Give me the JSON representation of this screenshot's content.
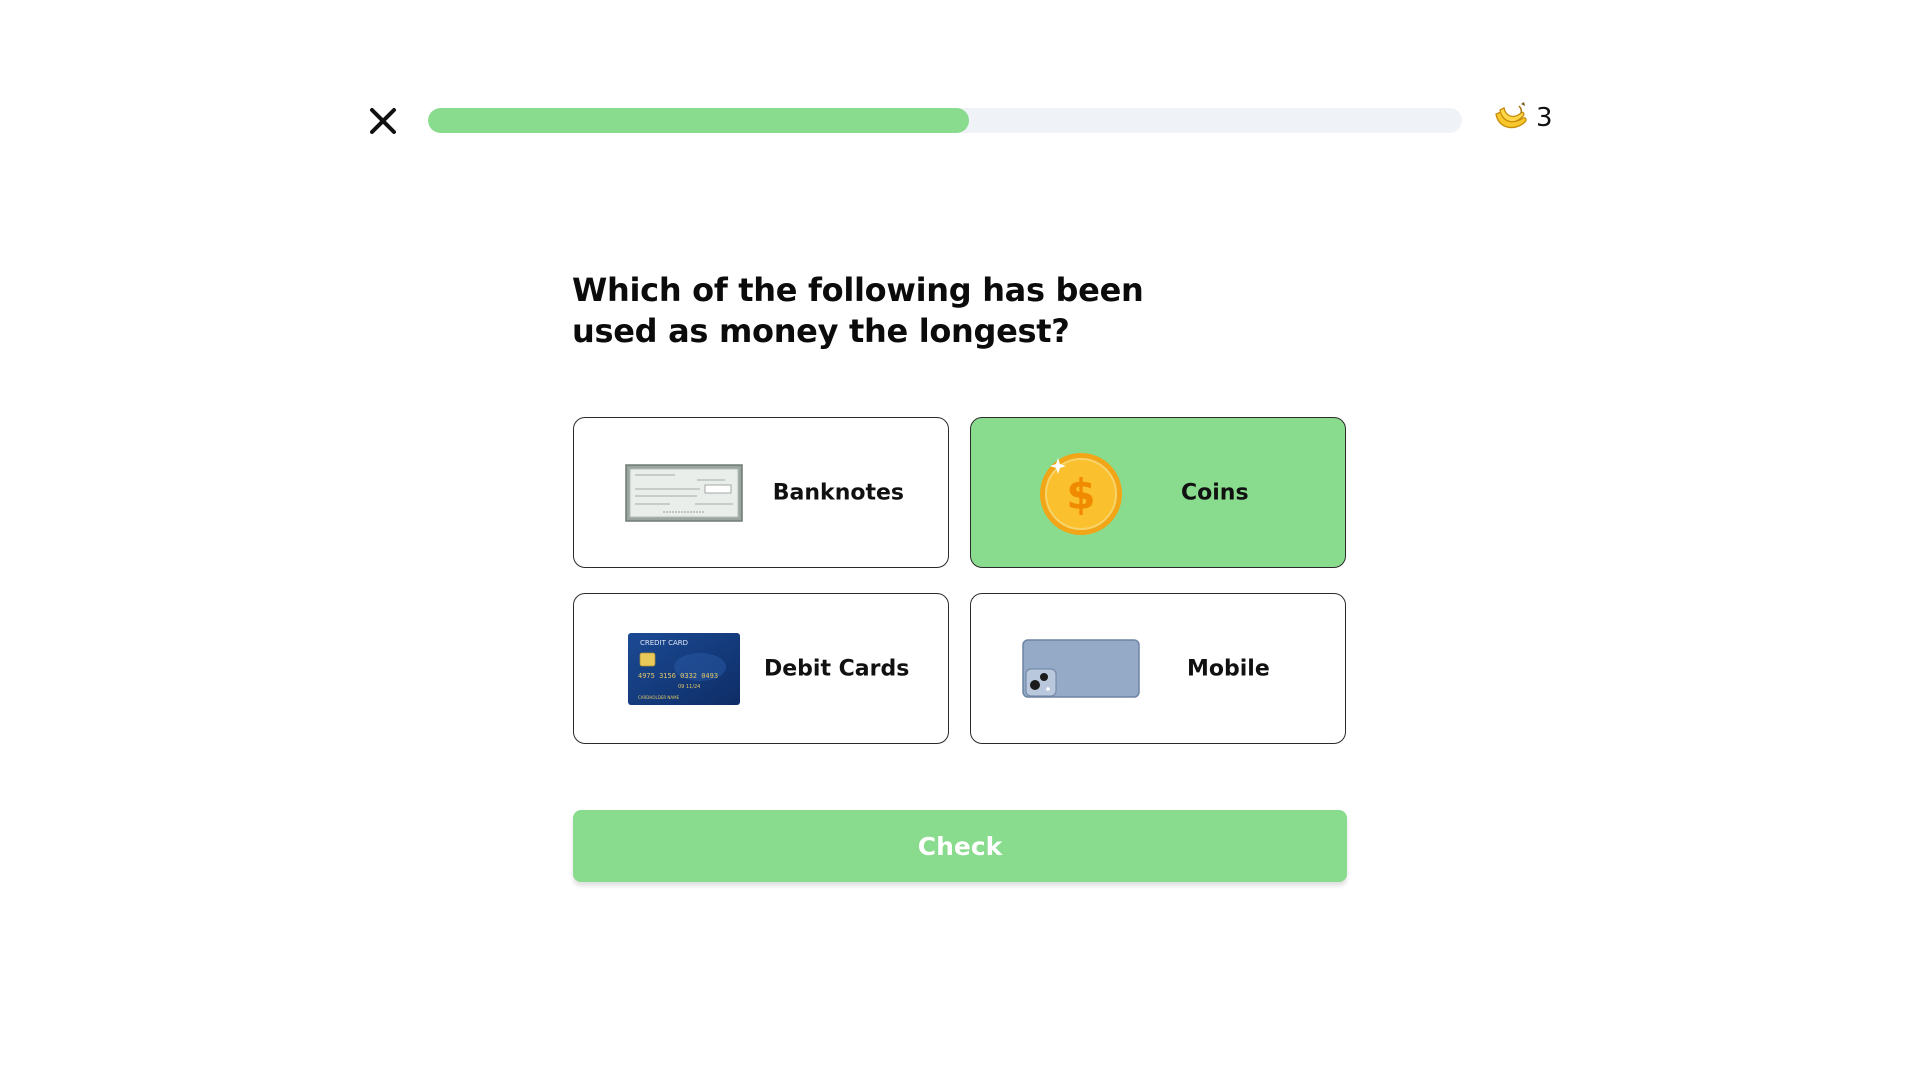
{
  "topbar": {
    "close_icon": "close-icon",
    "progress_percent": 52.3,
    "banana_icon": "banana-icon",
    "banana_count": "3"
  },
  "question": {
    "text": "Which of the following has been used as money the longest?"
  },
  "options": [
    {
      "label": "Banknotes",
      "icon": "cheque-image",
      "selected": false
    },
    {
      "label": "Coins",
      "icon": "dollar-coin-image",
      "selected": true
    },
    {
      "label": "Debit Cards",
      "icon": "credit-card-image",
      "selected": false
    },
    {
      "label": "Mobile",
      "icon": "mobile-phone-image",
      "selected": false
    }
  ],
  "check_button": {
    "label": "Check"
  },
  "colors": {
    "accent_green": "#89db8d",
    "progress_track": "#eff2f6",
    "text": "#111111"
  }
}
